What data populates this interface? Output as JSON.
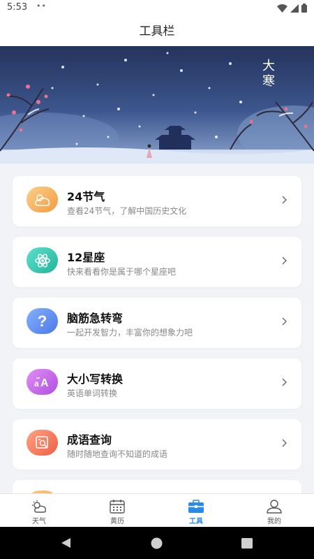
{
  "status": {
    "time": "5:53",
    "dots": "••"
  },
  "header": {
    "title": "工具栏"
  },
  "banner": {
    "caption": "大寒"
  },
  "tools": [
    {
      "title": "24节气",
      "desc": "查看24节气，了解中国历史文化",
      "icon": "weather-sun-cloud-icon",
      "color": "#f7b25a"
    },
    {
      "title": "12星座",
      "desc": "快来看看你是属于哪个星座吧",
      "icon": "atom-icon",
      "color": "#37c9b3"
    },
    {
      "title": "脑筋急转弯",
      "desc": "一起开发智力，丰富你的想象力吧",
      "icon": "question-icon",
      "color": "#5b8ef0"
    },
    {
      "title": "大小写转换",
      "desc": "英语单词转换",
      "icon": "case-convert-icon",
      "color": "#c065e8"
    },
    {
      "title": "成语查询",
      "desc": "随时随地查询不知道的成语",
      "icon": "search-idiom-icon",
      "color": "#f0775c"
    },
    {
      "title": "",
      "desc": "",
      "icon": "partial-card-icon",
      "color": "#f7b25a"
    }
  ],
  "tabbar": {
    "items": [
      {
        "label": "天气",
        "icon": "weather-icon"
      },
      {
        "label": "黄历",
        "icon": "calendar-icon"
      },
      {
        "label": "工具",
        "icon": "toolbox-icon",
        "active": true
      },
      {
        "label": "我的",
        "icon": "profile-icon"
      }
    ]
  },
  "colors": {
    "accent": "#2b8ae6",
    "background": "#f2f3f7"
  }
}
